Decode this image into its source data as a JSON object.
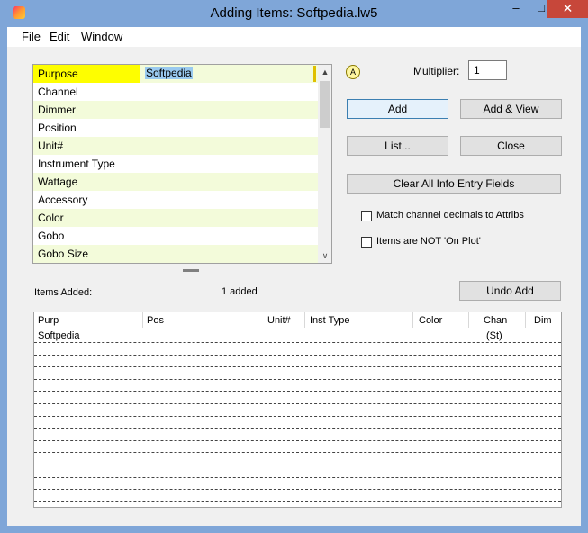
{
  "window": {
    "title": "Adding Items: Softpedia.lw5",
    "min_glyph": "–",
    "max_glyph": "□",
    "close_glyph": "✕"
  },
  "menu": [
    "File",
    "Edit",
    "Window"
  ],
  "fields": {
    "rows": [
      "Purpose",
      "Channel",
      "Dimmer",
      "Position",
      "Unit#",
      "Instrument Type",
      "Wattage",
      "Accessory",
      "Color",
      "Gobo",
      "Gobo Size"
    ],
    "selected_index": 0,
    "selected_value": "Softpedia"
  },
  "scroll": {
    "up": "▲",
    "down": "∨"
  },
  "multiplier": {
    "label": "Multiplier:",
    "value": "1"
  },
  "buttons": {
    "circle": "A",
    "add": "Add",
    "add_view": "Add & View",
    "list": "List...",
    "close": "Close",
    "clear": "Clear All Info Entry Fields",
    "undo": "Undo Add"
  },
  "checkboxes": {
    "match_decimals": {
      "label": "Match channel decimals to Attribs",
      "checked": false
    },
    "not_on_plot": {
      "label": "Items are NOT 'On Plot'",
      "checked": false
    }
  },
  "items_added": {
    "label": "Items Added:",
    "count_text": "1 added",
    "columns": [
      "Purp",
      "Pos",
      "Unit#",
      "Inst Type",
      "Color",
      "Chan",
      "Dim"
    ],
    "rows": [
      {
        "purp": "Softpedia",
        "chan": "(St)"
      }
    ]
  },
  "colors": {
    "selected_label": "#fefe00",
    "alt_row": "#f3fbda",
    "selection": "#99c9ef",
    "close_button": "#c7473a",
    "frame": "#7fa6d8"
  }
}
